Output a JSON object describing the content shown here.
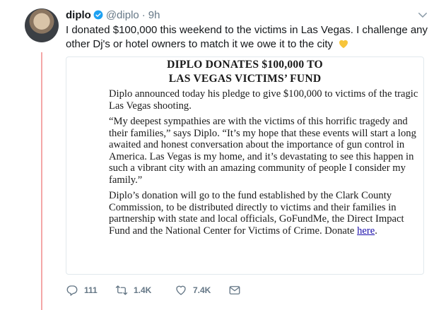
{
  "tweet": {
    "display_name": "diplo",
    "handle": "@diplo",
    "separator": "·",
    "time": "9h",
    "text": "I donated $100,000 this weekend to the victims in Las Vegas. I challenge any other Dj's or hotel owners to match it we owe it to the city"
  },
  "document": {
    "title_line1": "DIPLO DONATES $100,000 TO",
    "title_line2": "LAS VEGAS VICTIMS’ FUND",
    "paragraph1": "Diplo announced today his pledge to give $100,000 to victims of the tragic Las Vegas shooting.",
    "paragraph2": "“My deepest sympathies are with the victims of this horrific tragedy and their families,” says Diplo. “It’s my hope that these events will start a long awaited and honest conversation about the importance of gun control in America. Las Vegas is my home, and it’s devastating to see this happen in such a vibrant city with an amazing community of people I consider my family.”",
    "paragraph3_text": "Diplo’s donation will go to the fund established by the Clark County Commission, to be distributed directly to victims and their families in partnership with state and local officials, GoFundMe, the Direct Impact Fund and the National Center for Victims of Crime. Donate ",
    "link_text": "here",
    "paragraph3_end": "."
  },
  "actions": {
    "reply_count": "111",
    "retweet_count": "1.4K",
    "like_count": "7.4K"
  },
  "colors": {
    "thread_line": "#f4a7a7",
    "verified": "#1da1f2",
    "heart_emoji": "#f7c53b",
    "muted": "#657786"
  },
  "icons": {
    "verified": "verified-badge-icon",
    "chevron": "chevron-down-icon",
    "reply": "reply-icon",
    "retweet": "retweet-icon",
    "like": "heart-icon",
    "message": "envelope-icon",
    "emoji": "yellow-heart-emoji"
  }
}
